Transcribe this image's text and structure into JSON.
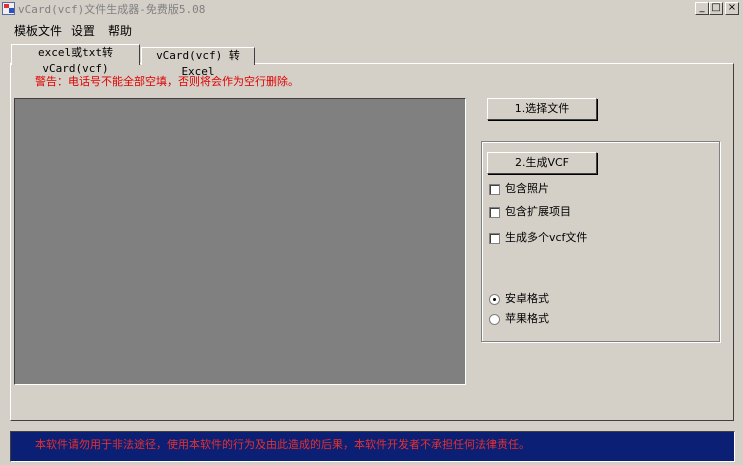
{
  "window": {
    "title": "vCard(vcf)文件生成器-免费版5.08",
    "minimize_glyph": "_",
    "maximize_glyph": "□",
    "close_glyph": "×"
  },
  "menu": [
    "模板文件",
    "设置",
    "帮助"
  ],
  "tabs": [
    {
      "label": "excel或txt转vCard(vcf)",
      "active": true
    },
    {
      "label": "vCard(vcf) 转 Excel",
      "active": false
    }
  ],
  "warning": "警告：电话号不能全部空填，否则将会作为空行删除。",
  "buttons": {
    "select_file": "1.选择文件",
    "generate_vcf": "2.生成VCF"
  },
  "checkboxes": [
    {
      "label": "包含照片",
      "checked": false
    },
    {
      "label": "包含扩展项目",
      "checked": false
    },
    {
      "label": "生成多个vcf文件",
      "checked": false
    }
  ],
  "radios": [
    {
      "label": "安卓格式",
      "selected": true
    },
    {
      "label": "苹果格式",
      "selected": false
    }
  ],
  "status": "本软件请勿用于非法途径，使用本软件的行为及由此造成的后果，本软件开发者不承担任何法律责任。",
  "colors": {
    "warning": "#e00000",
    "status_bg": "#0b1f74",
    "status_text": "#e53030",
    "preview_bg": "#808080"
  }
}
